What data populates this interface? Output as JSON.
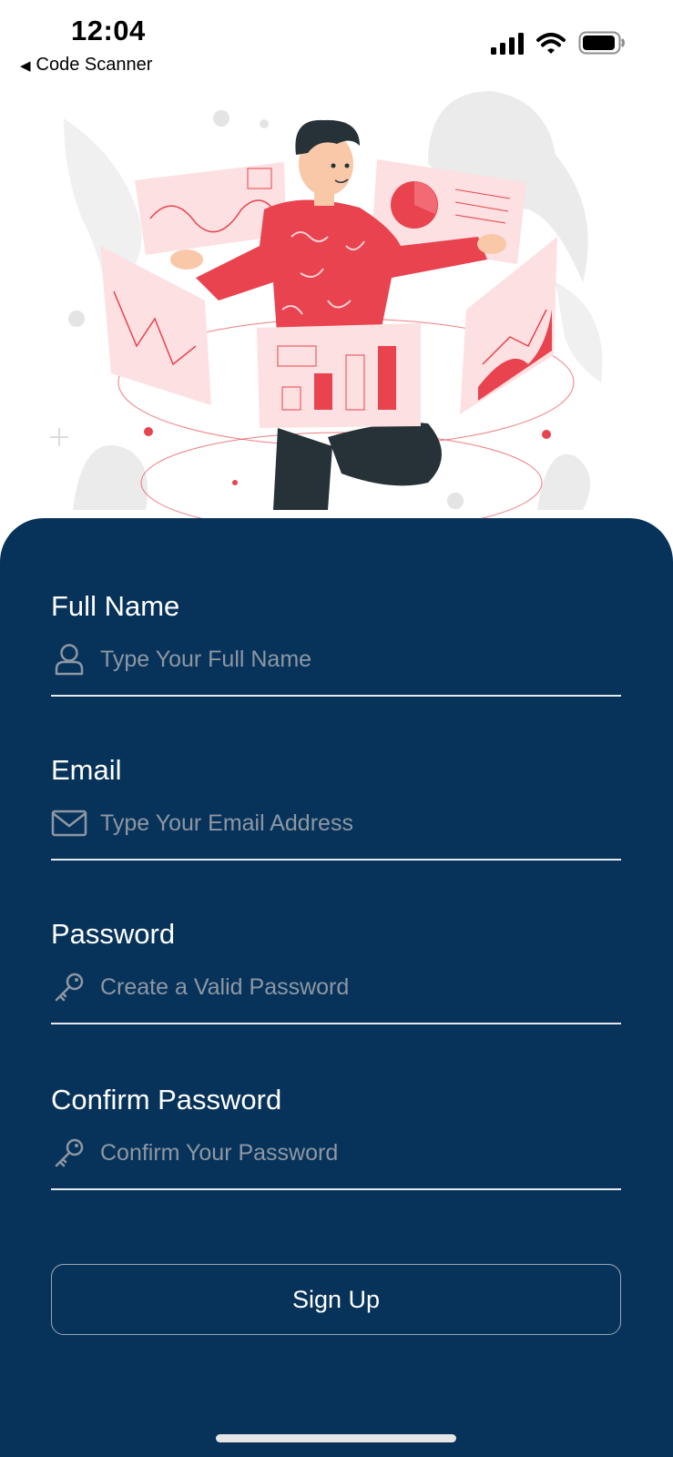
{
  "status_bar": {
    "time": "12:04",
    "back_label": "Code Scanner",
    "icons": [
      "signal-icon",
      "wifi-icon",
      "battery-icon"
    ]
  },
  "illustration": {
    "icon": "data-dashboard-illustration"
  },
  "form": {
    "fields": [
      {
        "label": "Full Name",
        "placeholder": "Type Your Full Name",
        "icon": "user-icon"
      },
      {
        "label": "Email",
        "placeholder": "Type Your Email Address",
        "icon": "mail-icon"
      },
      {
        "label": "Password",
        "placeholder": "Create a Valid Password",
        "icon": "key-icon"
      },
      {
        "label": "Confirm Password",
        "placeholder": "Confirm Your Password",
        "icon": "key-icon"
      }
    ],
    "submit_label": "Sign Up"
  },
  "colors": {
    "panel": "#07335a",
    "accent": "#e8434f",
    "placeholder": "#8e97a3"
  }
}
